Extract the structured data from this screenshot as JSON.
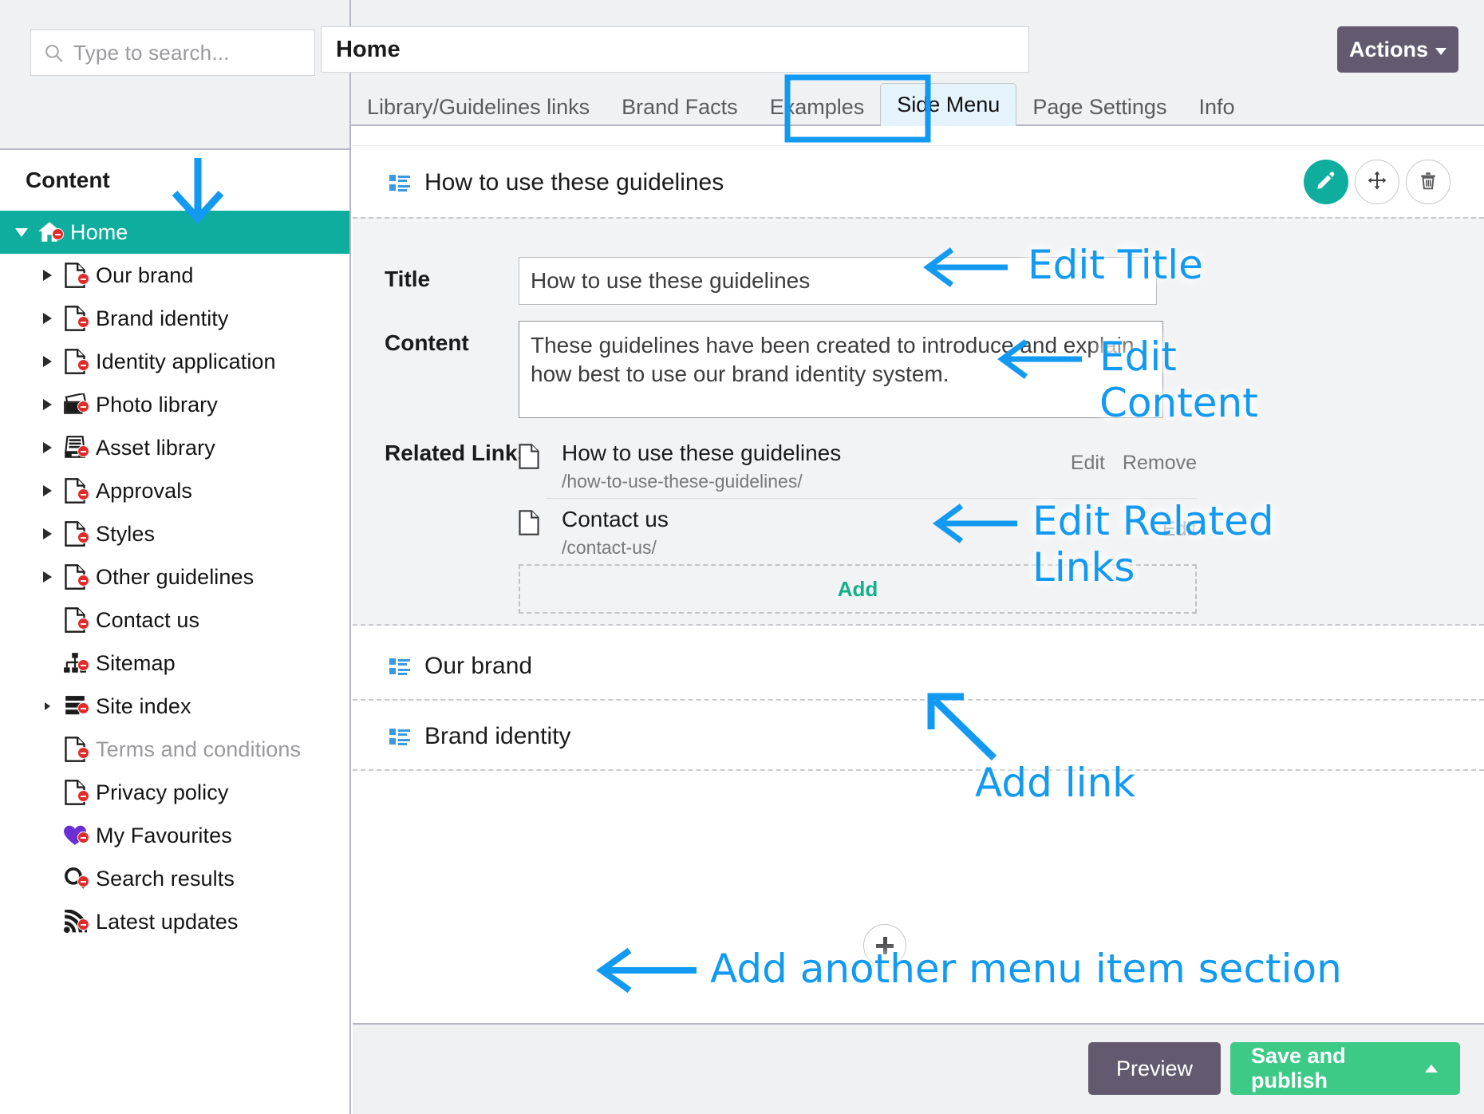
{
  "search": {
    "placeholder": "Type to search...",
    "icon": "search-icon"
  },
  "sidebar": {
    "header": "Content",
    "items": [
      {
        "label": "Home",
        "icon": "home-icon",
        "caret": "down",
        "selected": true,
        "indent": 0,
        "muted": false
      },
      {
        "label": "Our brand",
        "icon": "file-icon",
        "caret": "right",
        "selected": false,
        "indent": 1,
        "muted": false
      },
      {
        "label": "Brand identity",
        "icon": "file-icon",
        "caret": "right",
        "selected": false,
        "indent": 1,
        "muted": false
      },
      {
        "label": "Identity application",
        "icon": "file-icon",
        "caret": "right",
        "selected": false,
        "indent": 1,
        "muted": false
      },
      {
        "label": "Photo library",
        "icon": "photos-icon",
        "caret": "right",
        "selected": false,
        "indent": 1,
        "muted": false
      },
      {
        "label": "Asset library",
        "icon": "archive-icon",
        "caret": "right",
        "selected": false,
        "indent": 1,
        "muted": false
      },
      {
        "label": "Approvals",
        "icon": "file-icon",
        "caret": "right",
        "selected": false,
        "indent": 1,
        "muted": false
      },
      {
        "label": "Styles",
        "icon": "file-icon",
        "caret": "right",
        "selected": false,
        "indent": 1,
        "muted": false
      },
      {
        "label": "Other guidelines",
        "icon": "file-icon",
        "caret": "right",
        "selected": false,
        "indent": 1,
        "muted": false
      },
      {
        "label": "Contact us",
        "icon": "file-icon",
        "caret": "none",
        "selected": false,
        "indent": 1,
        "muted": false
      },
      {
        "label": "Sitemap",
        "icon": "sitemap-icon",
        "caret": "none",
        "selected": false,
        "indent": 1,
        "muted": false
      },
      {
        "label": "Site index",
        "icon": "index-icon",
        "caret": "small",
        "selected": false,
        "indent": 1,
        "muted": false
      },
      {
        "label": "Terms and conditions",
        "icon": "file-icon",
        "caret": "none",
        "selected": false,
        "indent": 1,
        "muted": true
      },
      {
        "label": "Privacy policy",
        "icon": "file-icon",
        "caret": "none",
        "selected": false,
        "indent": 1,
        "muted": false
      },
      {
        "label": "My Favourites",
        "icon": "heart-icon",
        "caret": "none",
        "selected": false,
        "indent": 1,
        "muted": false
      },
      {
        "label": "Search results",
        "icon": "search-icon",
        "caret": "none",
        "selected": false,
        "indent": 1,
        "muted": false
      },
      {
        "label": "Latest updates",
        "icon": "rss-icon",
        "caret": "none",
        "selected": false,
        "indent": 1,
        "muted": false
      }
    ]
  },
  "topbar": {
    "page_name": "Home",
    "actions_label": "Actions",
    "tabs": [
      {
        "label": "Library/Guidelines links",
        "active": false
      },
      {
        "label": "Brand Facts",
        "active": false
      },
      {
        "label": "Examples",
        "active": false
      },
      {
        "label": "Side Menu",
        "active": true
      },
      {
        "label": "Page Settings",
        "active": false
      },
      {
        "label": "Info",
        "active": false
      }
    ]
  },
  "main": {
    "sections": [
      {
        "title": "How to use these guidelines",
        "expanded": true
      },
      {
        "title": "Our brand",
        "expanded": false
      },
      {
        "title": "Brand identity",
        "expanded": false
      }
    ],
    "header_buttons": [
      {
        "name": "edit-section-button",
        "icon": "pencil-icon",
        "style": "fill"
      },
      {
        "name": "move-section-button",
        "icon": "move-icon",
        "style": "outline"
      },
      {
        "name": "delete-section-button",
        "icon": "trash-icon",
        "style": "outline"
      }
    ],
    "form": {
      "title_label": "Title",
      "title_value": "How to use these guidelines",
      "content_label": "Content",
      "content_value": "These guidelines have been created to introduce and explain how best to use our brand identity system.",
      "related_label": "Related Links",
      "related_links": [
        {
          "title": "How to use these guidelines",
          "url": "/how-to-use-these-guidelines/",
          "edit": "Edit",
          "remove": "Remove"
        },
        {
          "title": "Contact us",
          "url": "/contact-us/",
          "edit": "Edit",
          "remove": ""
        }
      ],
      "add_label": "Add"
    },
    "add_section_button": "add-section-button"
  },
  "footer": {
    "preview_label": "Preview",
    "publish_label": "Save and publish"
  },
  "annotations": [
    {
      "id": "a1",
      "text": "Edit Title"
    },
    {
      "id": "a2",
      "text": "Edit\nContent"
    },
    {
      "id": "a3",
      "text": "Edit Related\nLinks"
    },
    {
      "id": "a4",
      "text": "Add link"
    },
    {
      "id": "a5",
      "text": "Add another menu item section"
    }
  ],
  "colors": {
    "accent_teal": "#0ead9e",
    "annotation_blue": "#129af2",
    "actions_purple": "#645a6f",
    "publish_green": "#3dca87",
    "add_green": "#14b08b",
    "deny_red": "#e02b2b",
    "tab_active_bg": "#e4f3fc",
    "favourite_purple": "#6b2fd4"
  }
}
